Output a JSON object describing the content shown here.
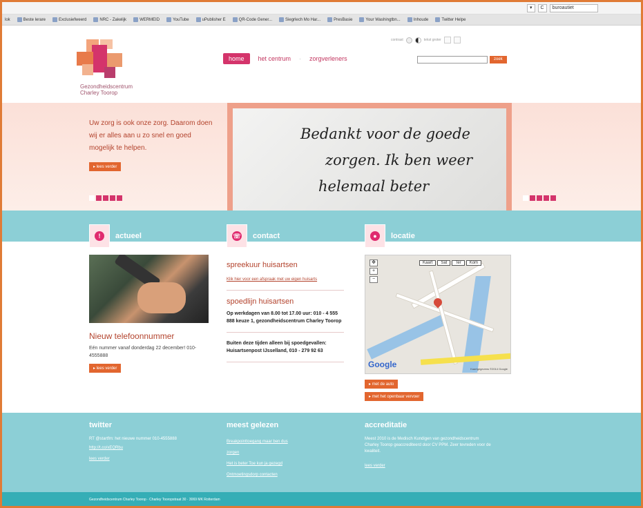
{
  "browser": {
    "address_segments": [
      "▾",
      "C",
      "buroautiet"
    ],
    "bookmarks": [
      "lok",
      "Beste lerare",
      "Exclusiefweerd",
      "NRC - Zakelijk",
      "WERMEID",
      "YouTube",
      "uPublisher E",
      "QR-Code Gener...",
      "Siegrlech Mo Har...",
      "PresBasie",
      "Your Washingtbn...",
      "Inhoude",
      "Twitter Helpe"
    ]
  },
  "header": {
    "logo_text_line1": "Gezondheidscentrum",
    "logo_text_line2": "Charley Toorop",
    "nav": {
      "home": "home",
      "centrum": "het centrum",
      "zorg": "zorgverleners"
    },
    "textsize_label": "contrast",
    "textsize_label2": "tekst groter",
    "search_button": "zoek",
    "search_value": ""
  },
  "hero": {
    "text": "Uw zorg is ook onze zorg. Daarom doen wij er alles aan u zo snel en goed mogelijk te helpen.",
    "button": "lees verder",
    "handwriting_line1": "Bedankt voor de goede",
    "handwriting_line2": "zorgen. Ik ben weer",
    "handwriting_line3": "helemaal beter"
  },
  "sections": {
    "actueel": "actueel",
    "contact": "contact",
    "locatie": "locatie"
  },
  "news": {
    "title": "Nieuw telefoonnummer",
    "body": "Eén nummer vanaf donderdag 22 december! 010-4555888",
    "button": "lees verder"
  },
  "contact": {
    "title1": "spreekuur huisartsen",
    "link1": "Klik hier voor een afspraak met uw eigen huisarts",
    "title2": "spoedlijn huisartsen",
    "text1": "Op werkdagen van 8.00 tot 17.00 uur: 010 - 4 555 888 keuze 1, gezondheidscentrum Charley Toorop",
    "text2": "Buiten deze tijden alleen bij spoedgevallen: Huisartsenpost IJsselland, 010 - 279 92 63"
  },
  "map": {
    "controls": [
      "Kaart",
      "Sat",
      "Ter",
      "Kom"
    ],
    "google": "Google",
    "copyright": "Kaartgegevens ©2014 Google",
    "btn1": "met de auto",
    "btn2": "met het openbaar vervoer"
  },
  "footer": {
    "twitter_title": "twitter",
    "twitter_text": "RT @startfm: het nieuwe nummer 010-4555888",
    "twitter_link": "http://t.co/xEQRbu",
    "twitter_more": "lees verder",
    "meest_title": "meest gelezen",
    "meest_links": [
      "Breakpointtoegang maar ben dus",
      "zorgen",
      "Het is beter Toe kun ja gezegd",
      "Ontmoetingsdorp contacten"
    ],
    "accred_title": "accreditatie",
    "accred_text": "Meest 2010 is de Medisch Kundigen van gezondheidscentrum Charley Toorop geaccrediteerd door CV PPM. Zeer tevreden voor de kwaliteit.",
    "accred_link": "lees verder",
    "bottom": "Gezondheidscentrum Charley Toorop · Charley Tooropstraat 30 · 3069 MK Rotterdam"
  }
}
